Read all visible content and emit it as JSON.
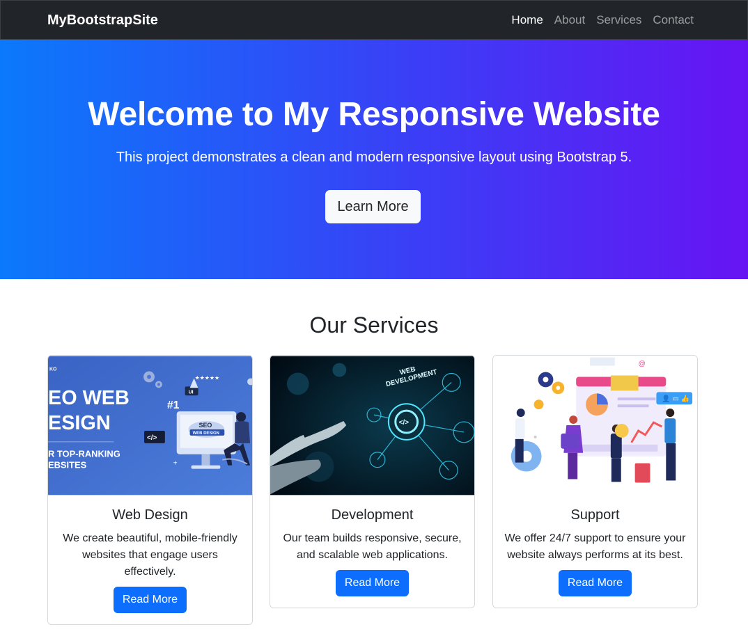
{
  "navbar": {
    "brand": "MyBootstrapSite",
    "links": [
      {
        "label": "Home",
        "active": true
      },
      {
        "label": "About",
        "active": false
      },
      {
        "label": "Services",
        "active": false
      },
      {
        "label": "Contact",
        "active": false
      }
    ]
  },
  "hero": {
    "title": "Welcome to My Responsive Website",
    "subtitle": "This project demonstrates a clean and modern responsive layout using Bootstrap 5.",
    "button_label": "Learn More",
    "gradient_start": "#0b79fb",
    "gradient_end": "#6714f3"
  },
  "services": {
    "title": "Our Services",
    "cards": [
      {
        "image_text": {
          "brand": "KO",
          "line1": "EO WEB",
          "line2": "ESIGN",
          "line3": "R TOP-RANKING",
          "line4": "EBSITES",
          "badge": "SEO",
          "badge_sub": "WEB DESIGN",
          "rank": "#1",
          "ui": "UI",
          "code": "</>"
        },
        "title": "Web Design",
        "text": "We create beautiful, mobile-friendly websites that engage users effectively.",
        "button_label": "Read More"
      },
      {
        "image_text": {
          "line1": "WEB",
          "line2": "DEVELOPMENT"
        },
        "title": "Development",
        "text": "Our team builds responsive, secure, and scalable web applications.",
        "button_label": "Read More"
      },
      {
        "title": "Support",
        "text": "We offer 24/7 support to ensure your website always performs at its best.",
        "button_label": "Read More"
      }
    ]
  },
  "colors": {
    "navbar_bg": "#212529",
    "primary_button": "#0d6efd",
    "light_button": "#f8f9fa"
  }
}
